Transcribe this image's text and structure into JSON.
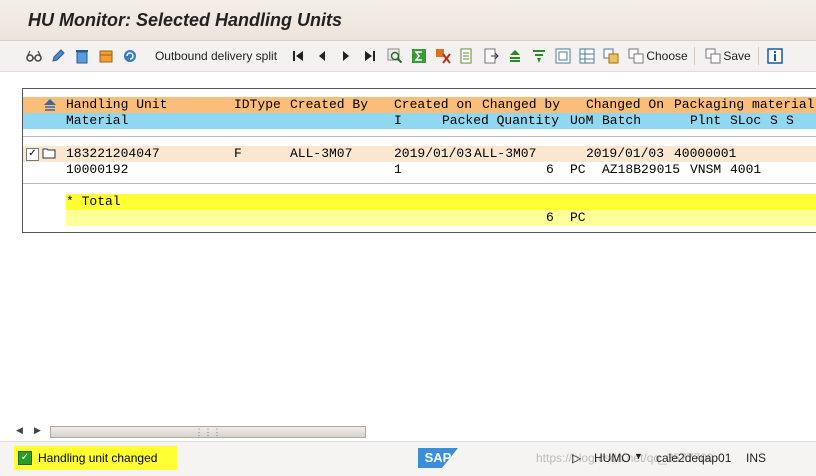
{
  "window": {
    "title": "HU Monitor: Selected Handling Units"
  },
  "toolbar": {
    "outbound_split_label": "Outbound delivery split",
    "choose_label": "Choose",
    "save_label": "Save"
  },
  "grid": {
    "header1": {
      "handling_unit": "Handling Unit",
      "idtype": "IDType",
      "created_by": "Created By",
      "created_on": "Created on",
      "changed_by": "Changed by",
      "changed_on": "Changed On",
      "packaging_material": "Packaging material"
    },
    "header2": {
      "material": "Material",
      "i": "I",
      "packed_quantity": "Packed Quantity",
      "uom": "UoM",
      "batch": "Batch",
      "plnt": "Plnt",
      "sloc": "SLoc",
      "s1": "S",
      "s2": "S"
    },
    "rows": [
      {
        "handling_unit": "183221204047",
        "idtype": "F",
        "created_by": "ALL-3M07",
        "created_on": "2019/01/03",
        "changed_by": "ALL-3M07",
        "changed_on": "2019/01/03",
        "packaging_material": "40000001",
        "material": "10000192",
        "i": "1",
        "packed_quantity": "6",
        "uom": "PC",
        "batch": "AZ18B29015",
        "plnt": "VNSM",
        "sloc": "4001"
      }
    ],
    "total": {
      "label": "* Total",
      "quantity": "6",
      "uom": "PC"
    }
  },
  "status": {
    "message": "Handling unit changed",
    "sap_logo": "SAP",
    "transaction": "HUMO",
    "server": "cale2deqap01",
    "mode": "INS",
    "watermark": "https://blog.csdn.net/qq_3577700"
  },
  "colors": {
    "header1_bg": "#fbbd7a",
    "header2_bg": "#8fd8f0",
    "row_bg": "#fbe6d0",
    "total_bg": "#ffff33",
    "status_highlight": "#ffff33"
  }
}
